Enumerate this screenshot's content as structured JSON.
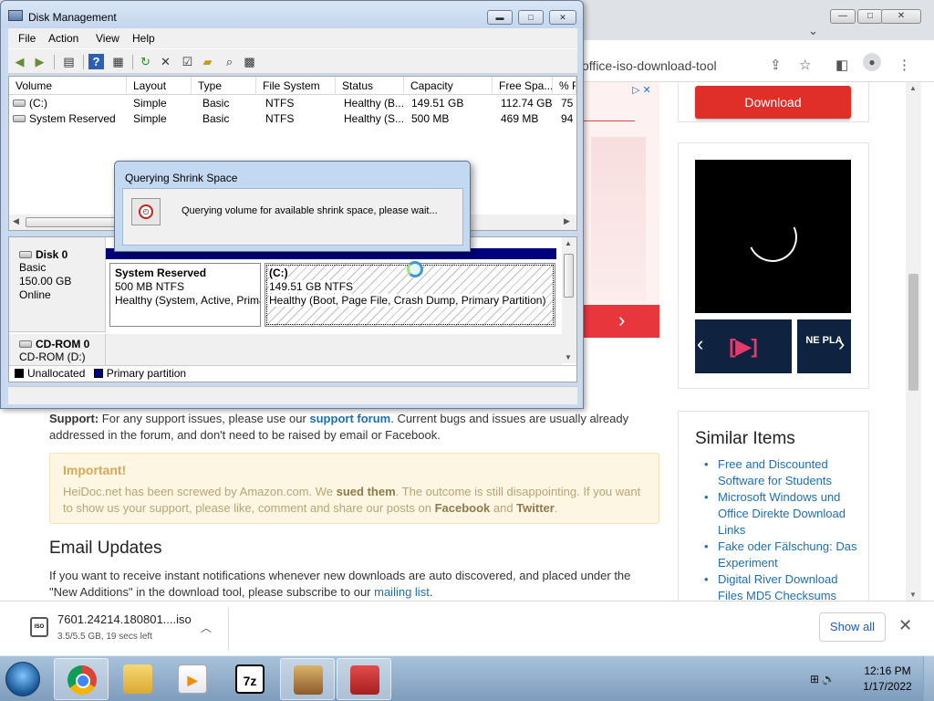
{
  "chrome": {
    "address_fragment": "office-iso-download-tool",
    "min_label": "—",
    "max_label": "□",
    "close_label": "✕",
    "tab_chevron": "⌄"
  },
  "webpage": {
    "download_button": "Download",
    "ad_chevron": "›",
    "similar": {
      "title": "Similar Items",
      "items": [
        "Free and Discounted Software for Students",
        "Microsoft Windows und Office Direkte Download Links",
        "Fake oder Fälschung: Das Experiment",
        "Digital River Download Files MD5 Checksums"
      ]
    },
    "support": {
      "label": "Support:",
      "text1": " For any support issues, please use our ",
      "link": "support forum",
      "text2": ". Current bugs and issues are usually already addressed in the forum, and don't need to be raised by email or Facebook."
    },
    "important": {
      "title": "Important!",
      "text1": "HeiDoc.net has been screwed by Amazon.com. We ",
      "bold1": "sued them",
      "text2": ". The outcome is still disappointing. If you want to show us your support, please like, comment and share our posts on ",
      "bold2": "Facebook",
      "text3": " and ",
      "bold3": "Twitter",
      "text4": "."
    },
    "email": {
      "title": "Email Updates",
      "text1": "If you want to receive instant notifications whenever new downloads are auto discovered, and placed under the \"New Additions\" in the download tool, please subscribe to our ",
      "link": "mailing list",
      "text2": "."
    }
  },
  "download_shelf": {
    "filename": "7601.24214.180801....iso",
    "status": "3.5/5.5 GB, 19 secs left",
    "show_all": "Show all",
    "icon_text": "ISO"
  },
  "disk_mgmt": {
    "title": "Disk Management",
    "menu": [
      "File",
      "Action",
      "View",
      "Help"
    ],
    "columns": [
      "Volume",
      "Layout",
      "Type",
      "File System",
      "Status",
      "Capacity",
      "Free Spa...",
      "% F"
    ],
    "rows": [
      [
        "(C:)",
        "Simple",
        "Basic",
        "NTFS",
        "Healthy (B...",
        "149.51 GB",
        "112.74 GB",
        "75"
      ],
      [
        "System Reserved",
        "Simple",
        "Basic",
        "NTFS",
        "Healthy (S...",
        "500 MB",
        "469 MB",
        "94"
      ]
    ],
    "disk0": {
      "name": "Disk 0",
      "type": "Basic",
      "size": "150.00 GB",
      "status": "Online"
    },
    "partitions": {
      "sys_title": "System Reserved",
      "sys_size": "500 MB NTFS",
      "sys_status": "Healthy (System, Active, Primary Partition)",
      "c_title": "(C:)",
      "c_size": "149.51 GB NTFS",
      "c_status": "Healthy (Boot, Page File, Crash Dump, Primary Partition)"
    },
    "cdrom": {
      "name": "CD-ROM 0",
      "drive": "CD-ROM (D:)"
    },
    "legend": {
      "unallocated": "Unallocated",
      "primary": "Primary partition"
    }
  },
  "dialog": {
    "title": "Querying Shrink Space",
    "message": "Querying volume for available shrink space, please wait..."
  },
  "taskbar": {
    "seven_zip": "7z",
    "time": "12:16 PM",
    "date": "1/17/2022"
  }
}
